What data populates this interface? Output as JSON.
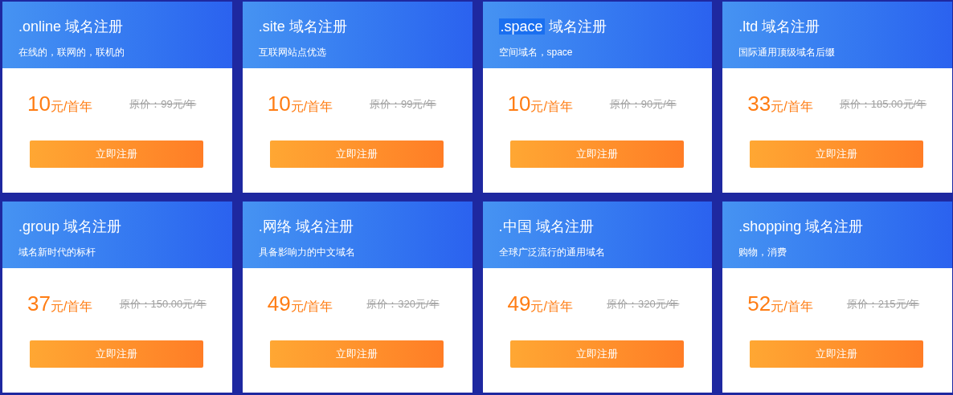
{
  "cards": [
    {
      "tld": ".online",
      "tld_selected": false,
      "label": "域名注册",
      "tagline": "在线的，联网的，联机的",
      "price": "10",
      "unit": "元/首年",
      "original_price": "原价：99元/年",
      "button": "立即注册"
    },
    {
      "tld": ".site",
      "tld_selected": false,
      "label": "域名注册",
      "tagline": "互联网站点优选",
      "price": "10",
      "unit": "元/首年",
      "original_price": "原价：99元/年",
      "button": "立即注册"
    },
    {
      "tld": ".space",
      "tld_selected": true,
      "label": "域名注册",
      "tagline": "空间域名，space",
      "price": "10",
      "unit": "元/首年",
      "original_price": "原价：90元/年",
      "button": "立即注册"
    },
    {
      "tld": ".ltd",
      "tld_selected": false,
      "label": "域名注册",
      "tagline": "国际通用顶级域名后缀",
      "price": "33",
      "unit": "元/首年",
      "original_price": "原价：185.00元/年",
      "button": "立即注册"
    },
    {
      "tld": ".group",
      "tld_selected": false,
      "label": "域名注册",
      "tagline": "域名新时代的标杆",
      "price": "37",
      "unit": "元/首年",
      "original_price": "原价：150.00元/年",
      "button": "立即注册"
    },
    {
      "tld": ".网络",
      "tld_selected": false,
      "label": "域名注册",
      "tagline": "具备影响力的中文域名",
      "price": "49",
      "unit": "元/首年",
      "original_price": "原价：320元/年",
      "button": "立即注册"
    },
    {
      "tld": ".中国",
      "tld_selected": false,
      "label": "域名注册",
      "tagline": "全球广泛流行的通用域名",
      "price": "49",
      "unit": "元/首年",
      "original_price": "原价：320元/年",
      "button": "立即注册"
    },
    {
      "tld": ".shopping",
      "tld_selected": false,
      "label": "域名注册",
      "tagline": "购物，消费",
      "price": "52",
      "unit": "元/首年",
      "original_price": "原价：215元/年",
      "button": "立即注册"
    }
  ]
}
